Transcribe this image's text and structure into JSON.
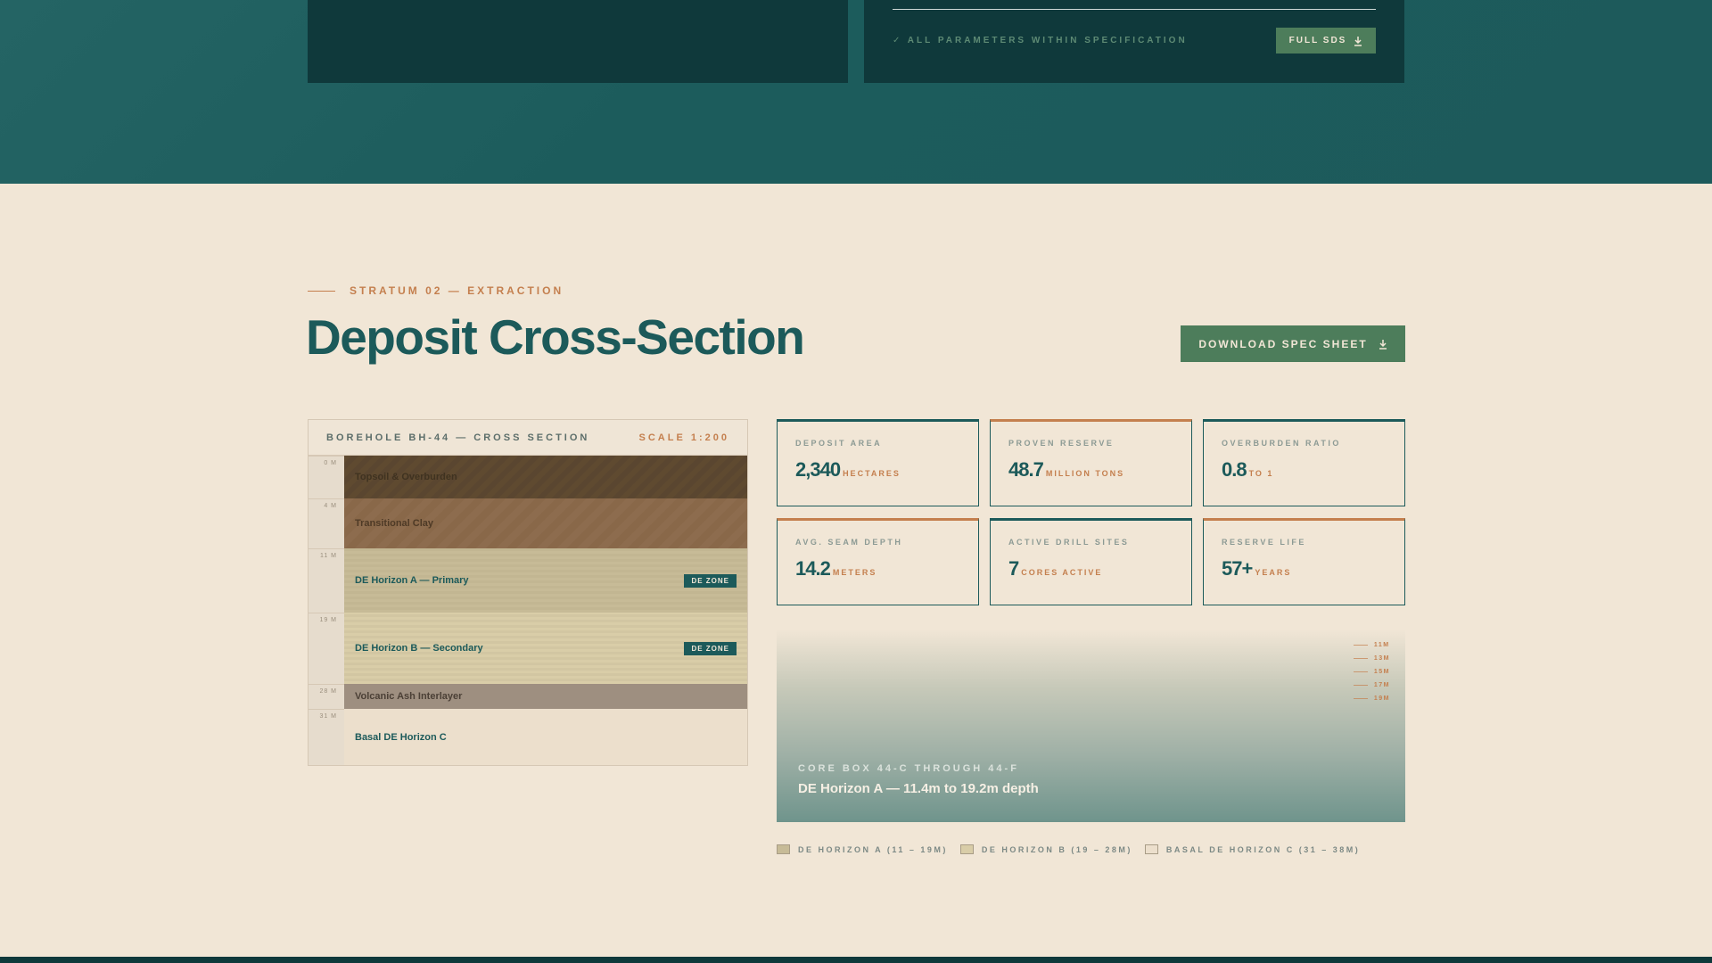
{
  "top_section": {
    "spec_status": "✓ ALL PARAMETERS WITHIN SPECIFICATION",
    "sds_button": "FULL SDS"
  },
  "section": {
    "eyebrow": "STRATUM 02 — EXTRACTION",
    "title": "Deposit Cross-Section",
    "download_button": "DOWNLOAD SPEC SHEET"
  },
  "borehole": {
    "title": "BOREHOLE BH-44 — CROSS SECTION",
    "scale": "SCALE 1:200",
    "layers": [
      {
        "depth": "0 M",
        "name": "Topsoil & Overburden",
        "badge": ""
      },
      {
        "depth": "4 M",
        "name": "Transitional Clay",
        "badge": ""
      },
      {
        "depth": "11 M",
        "name": "DE Horizon A — Primary",
        "badge": "DE ZONE"
      },
      {
        "depth": "19 M",
        "name": "DE Horizon B — Secondary",
        "badge": "DE ZONE"
      },
      {
        "depth": "28 M",
        "name": "Volcanic Ash Interlayer",
        "badge": ""
      },
      {
        "depth": "31 M",
        "name": "Basal DE Horizon C",
        "badge": ""
      }
    ]
  },
  "stats": [
    {
      "label": "DEPOSIT AREA",
      "value": "2,340",
      "unit": "HECTARES",
      "accent": "teal"
    },
    {
      "label": "PROVEN RESERVE",
      "value": "48.7",
      "unit": "MILLION TONS",
      "accent": "copper"
    },
    {
      "label": "OVERBURDEN RATIO",
      "value": "0.8",
      "unit": "TO 1",
      "accent": "teal"
    },
    {
      "label": "AVG. SEAM DEPTH",
      "value": "14.2",
      "unit": "METERS",
      "accent": "copper"
    },
    {
      "label": "ACTIVE DRILL SITES",
      "value": "7",
      "unit": "CORES ACTIVE",
      "accent": "teal"
    },
    {
      "label": "RESERVE LIFE",
      "value": "57+",
      "unit": "YEARS",
      "accent": "copper"
    }
  ],
  "core_panel": {
    "depth_ticks": [
      "11M",
      "13M",
      "15M",
      "17M",
      "19M"
    ],
    "box_id": "CORE BOX 44-C THROUGH 44-F",
    "description": "DE Horizon A — 11.4m to 19.2m depth"
  },
  "legend": [
    {
      "label": "DE HORIZON A (11 – 19M)",
      "color": "#c7bb97"
    },
    {
      "label": "DE HORIZON B (19 – 28M)",
      "color": "#d9cda8"
    },
    {
      "label": "BASAL DE HORIZON C (31 – 38M)",
      "color": "#ecdfcc"
    }
  ],
  "colors": {
    "teal": "#1c5a5a",
    "dark_teal": "#0f393b",
    "copper": "#c47f4e",
    "green_button": "#4d7d5b",
    "cream": "#f1e6d6"
  }
}
